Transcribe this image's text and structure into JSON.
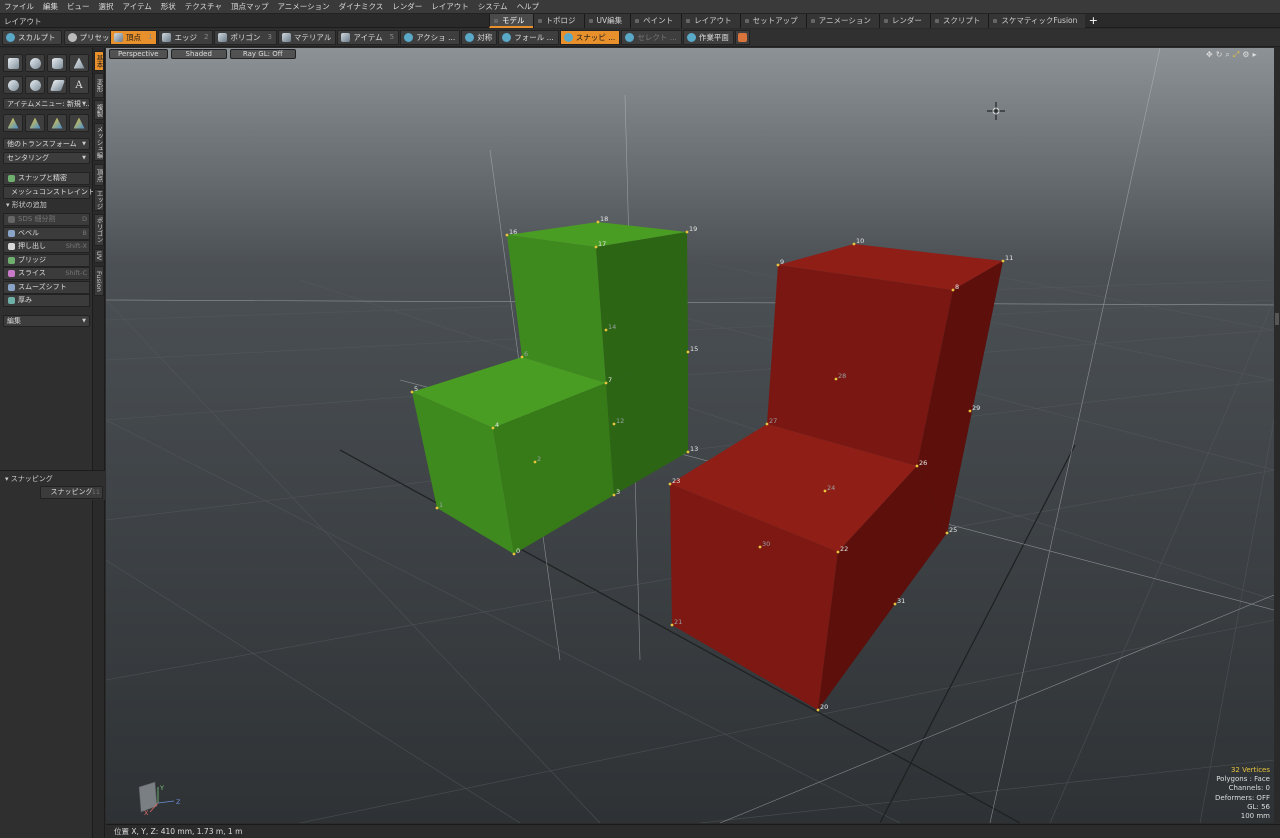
{
  "menu": [
    "ファイル",
    "編集",
    "ビュー",
    "選択",
    "アイテム",
    "形状",
    "テクスチャ",
    "頂点マップ",
    "アニメーション",
    "ダイナミクス",
    "レンダー",
    "レイアウト",
    "システム",
    "ヘルプ"
  ],
  "layout_label": "レイアウト",
  "tabs": [
    "モデル",
    "トポロジ",
    "UV編集",
    "ペイント",
    "レイアウト",
    "セットアップ",
    "アニメーション",
    "レンダー",
    "スクリプト",
    "スケマティックFusion"
  ],
  "active_tab": "モデル",
  "tabs_plus": "+",
  "toolbar": {
    "sculpt": "スカルプト",
    "preset": "プリセット",
    "modes": [
      {
        "label": "頂点",
        "num": "1",
        "active": true
      },
      {
        "label": "エッジ",
        "num": "2"
      },
      {
        "label": "ポリゴン",
        "num": "3"
      },
      {
        "label": "マテリアル",
        "num": ""
      },
      {
        "label": "アイテム",
        "num": "5"
      },
      {
        "label": "アクショ ...",
        "num": ""
      },
      {
        "label": "対称",
        "num": ""
      },
      {
        "label": "フォール ...",
        "num": ""
      },
      {
        "label": "スナッピ ...",
        "num": "",
        "active": true
      },
      {
        "label": "セレクト ...",
        "num": "",
        "dim": true
      },
      {
        "label": "作業平面",
        "num": ""
      }
    ]
  },
  "sidebar": {
    "item_menu": "アイテムメニュー: 新規 ...",
    "other_transform": "他のトランスフォーム",
    "centering": "センタリング",
    "snap_precision": "スナップと精密",
    "mesh_constraint": "メッシュコンストレイント",
    "add_shape": "形状の追加",
    "tools": [
      {
        "label": "SDS 細分割",
        "shortcut": "D",
        "dim": true,
        "color": "#666666"
      },
      {
        "label": "ベベル",
        "shortcut": "B",
        "color": "#8aa4c8"
      },
      {
        "label": "押し出し",
        "shortcut": "Shift-X",
        "color": "#d8d8d8"
      },
      {
        "label": "ブリッジ",
        "shortcut": "",
        "color": "#6fb06f"
      },
      {
        "label": "スライス",
        "shortcut": "Shift-C",
        "color": "#c87ac8"
      },
      {
        "label": "スムーズシフト",
        "shortcut": "",
        "color": "#8aa4c8"
      },
      {
        "label": "厚み",
        "shortcut": "",
        "color": "#6fb0a8"
      }
    ],
    "edit": "編集",
    "snapping_header": "スナッピング",
    "snapping_btn": "スナッピング",
    "snapping_key": "F11"
  },
  "vtabs": [
    {
      "label": "基本",
      "active": true
    },
    {
      "label": "変形"
    },
    {
      "label": "複製"
    },
    {
      "label": "メッシュ編集"
    },
    {
      "label": "頂点"
    },
    {
      "label": "エッジ"
    },
    {
      "label": "ポリゴン"
    },
    {
      "label": "UV"
    },
    {
      "label": "Fusion"
    }
  ],
  "viewport": {
    "view": "Perspective",
    "shading": "Shaded",
    "raygl": "Ray GL: Off",
    "colors": {
      "green": "#3f8a1e",
      "red": "#8c1a14",
      "accent": "#e8902b",
      "vertex": "#e8c33d"
    }
  },
  "vertex_labels": [
    "0",
    "1",
    "2",
    "3",
    "4",
    "5",
    "6",
    "7",
    "8",
    "9",
    "10",
    "11",
    "12",
    "13",
    "14",
    "15",
    "16",
    "17",
    "18",
    "19",
    "20",
    "21",
    "22",
    "23",
    "24",
    "25",
    "26",
    "27",
    "28",
    "29",
    "30",
    "31"
  ],
  "axis_labels": {
    "y": "Y",
    "x": "X",
    "z": "Z"
  },
  "stats": {
    "vertices": "32 Vertices",
    "polygons": "Polygons : Face",
    "channels": "Channels: 0",
    "deformers": "Deformers: OFF",
    "gl": "GL: 56",
    "unit": "100 mm"
  },
  "status": "位置 X, Y, Z:   410 mm, 1.73 m, 1 m"
}
